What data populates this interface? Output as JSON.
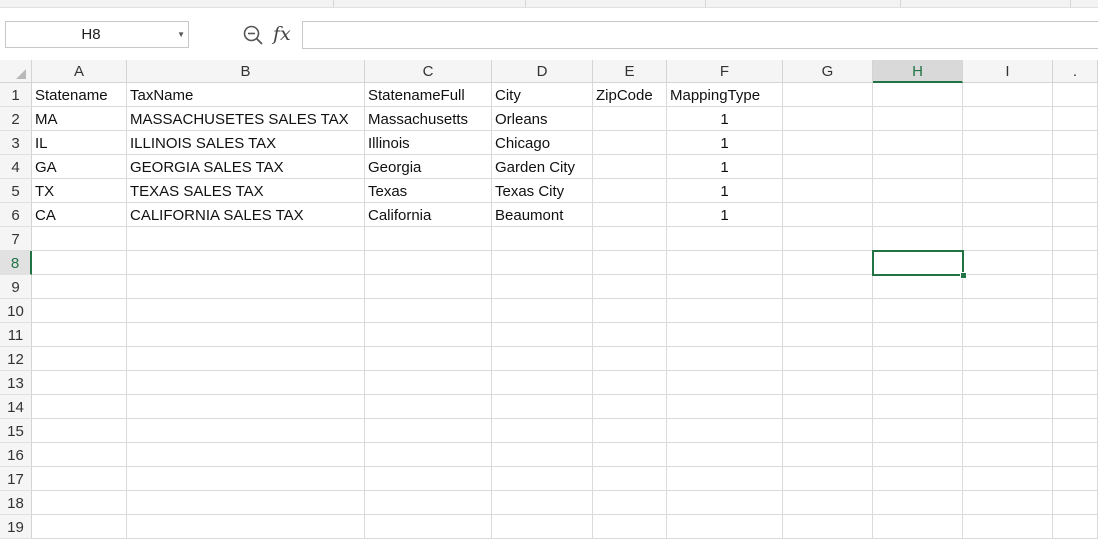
{
  "name_box": {
    "value": "H8"
  },
  "formula_bar": {
    "fx_label": "fx",
    "value": ""
  },
  "columns": [
    "A",
    "B",
    "C",
    "D",
    "E",
    "F",
    "G",
    "H",
    "I",
    "."
  ],
  "active_column": "H",
  "rows": [
    "1",
    "2",
    "3",
    "4",
    "5",
    "6",
    "7",
    "8",
    "9",
    "10",
    "11",
    "12",
    "13",
    "14",
    "15",
    "16",
    "17",
    "18",
    "19"
  ],
  "active_row": "8",
  "cells": [
    [
      "Statename",
      "TaxName",
      "StatenameFull",
      "City",
      "ZipCode",
      "MappingType"
    ],
    [
      "MA",
      "MASSACHUSETES SALES TAX",
      "Massachusetts",
      "Orleans",
      "",
      "1"
    ],
    [
      "IL",
      "ILLINOIS SALES TAX",
      "Illinois",
      "Chicago",
      "",
      "1"
    ],
    [
      "GA",
      "GEORGIA SALES TAX",
      "Georgia",
      "Garden City",
      "",
      "1"
    ],
    [
      "TX",
      "TEXAS SALES TAX",
      "Texas",
      "Texas City",
      "",
      "1"
    ],
    [
      "CA",
      "CALIFORNIA SALES TAX",
      "California",
      "Beaumont",
      "",
      "1"
    ]
  ],
  "colors": {
    "accent": "#217346",
    "header_bg": "#f5f5f5",
    "gridline": "#dadada"
  }
}
